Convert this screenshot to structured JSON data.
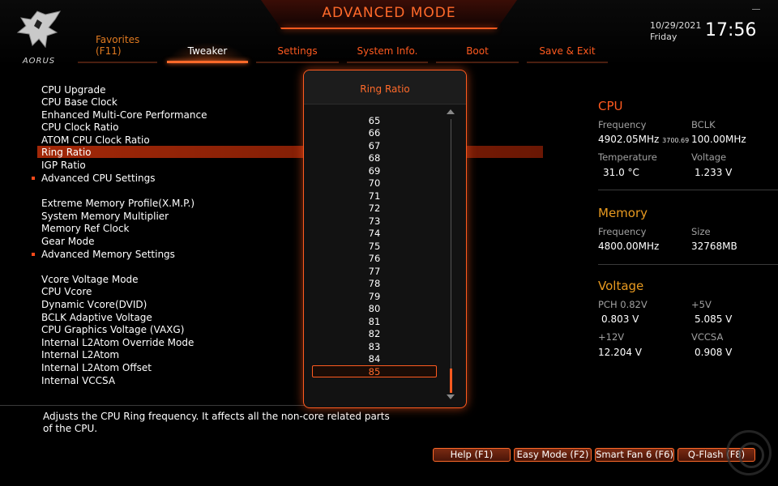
{
  "header": {
    "title": "ADVANCED MODE",
    "logo_text": "AORUS",
    "date": "10/29/2021",
    "day": "Friday",
    "time": "17:56"
  },
  "tabs": [
    {
      "label": "Favorites",
      "sub": "(F11)"
    },
    {
      "label": "Tweaker",
      "active": true
    },
    {
      "label": "Settings"
    },
    {
      "label": "System Info."
    },
    {
      "label": "Boot"
    },
    {
      "label": "Save & Exit"
    }
  ],
  "menu": {
    "items": [
      "CPU Upgrade",
      "CPU Base Clock",
      "Enhanced Multi-Core Performance",
      "CPU Clock Ratio",
      "ATOM CPU Clock Ratio",
      "Ring Ratio",
      "IGP Ratio",
      "Advanced CPU Settings",
      "Extreme Memory Profile(X.M.P.)",
      "System Memory Multiplier",
      "Memory Ref Clock",
      "Gear Mode",
      "Advanced Memory Settings",
      "Vcore Voltage Mode",
      "CPU Vcore",
      "Dynamic Vcore(DVID)",
      "BCLK Adaptive Voltage",
      "CPU Graphics Voltage (VAXG)",
      "Internal L2Atom Override Mode",
      "Internal L2Atom",
      "Internal L2Atom Offset",
      "Internal VCCSA"
    ],
    "selected": "Ring Ratio"
  },
  "description": "Adjusts the CPU Ring frequency. It affects all the non-core related parts of the CPU.",
  "popup": {
    "title": "Ring Ratio",
    "options": [
      "65",
      "66",
      "67",
      "68",
      "69",
      "70",
      "71",
      "72",
      "73",
      "74",
      "75",
      "76",
      "77",
      "78",
      "79",
      "80",
      "81",
      "82",
      "83",
      "84",
      "85"
    ],
    "selected": "85"
  },
  "cpu": {
    "title": "CPU",
    "freq_label": "Frequency",
    "freq_value": "4902.05MHz",
    "freq_sub": "3700.69",
    "bclk_label": "BCLK",
    "bclk_value": "100.00MHz",
    "temp_label": "Temperature",
    "temp_value": "31.0 °C",
    "volt_label": "Voltage",
    "volt_value": "1.233 V"
  },
  "memory": {
    "title": "Memory",
    "freq_label": "Frequency",
    "freq_value": "4800.00MHz",
    "size_label": "Size",
    "size_value": "32768MB"
  },
  "voltage": {
    "title": "Voltage",
    "pch_label": "PCH 0.82V",
    "pch_value": "0.803 V",
    "p5v_label": "+5V",
    "p5v_value": "5.085 V",
    "p12v_label": "+12V",
    "p12v_value": "12.204 V",
    "vccsa_label": "VCCSA",
    "vccsa_value": "0.908 V"
  },
  "footer": {
    "help": "Help (F1)",
    "easy": "Easy Mode (F2)",
    "fan": "Smart Fan 6 (F6)",
    "qflash": "Q-Flash (F8)"
  },
  "colors": {
    "accent": "#ff5a1f",
    "amber": "#e89a20",
    "highlight": "#a22808"
  }
}
